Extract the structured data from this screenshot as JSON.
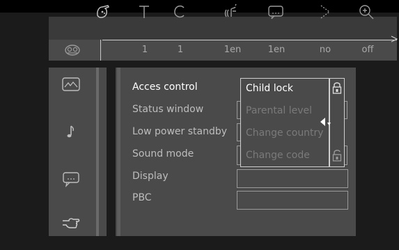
{
  "topbar": {
    "icons": [
      "angle-camera-icon",
      "title-icon",
      "chapter-icon",
      "audio-icon",
      "subtitle-icon",
      "play-mode-icon",
      "zoom-icon"
    ],
    "status_icon": "disc-reel-icon",
    "values": [
      "1",
      "1",
      "1en",
      "1en",
      "no",
      "off"
    ]
  },
  "sidebar": {
    "items": [
      {
        "icon": "picture-icon"
      },
      {
        "icon": "music-note-icon"
      },
      {
        "icon": "speech-bubble-icon"
      },
      {
        "icon": "hand-pointer-icon"
      }
    ]
  },
  "menu": {
    "items": [
      {
        "label": "Acces control",
        "active": true
      },
      {
        "label": "Status window",
        "active": false
      },
      {
        "label": "Low power standby",
        "active": false
      },
      {
        "label": "Sound mode",
        "active": false
      },
      {
        "label": "Display",
        "active": false
      },
      {
        "label": "PBC",
        "active": false
      }
    ]
  },
  "submenu": {
    "items": [
      {
        "label": "Child lock",
        "active": true
      },
      {
        "label": "Parental level",
        "active": false
      },
      {
        "label": "Change country",
        "active": false
      },
      {
        "label": "Change code",
        "active": false
      }
    ],
    "lock_icons": [
      "lock-closed-icon",
      "lock-open-icon"
    ],
    "pointer_icon": "left-arrow-pointer-icon"
  },
  "colors": {
    "background": "#1b1b1b",
    "panel": "#4a4a4a",
    "topbar": "#3a3a3a",
    "active_text": "#ffffff",
    "inactive_text": "#bdbdbd",
    "disabled_text": "#7a7a7a"
  }
}
